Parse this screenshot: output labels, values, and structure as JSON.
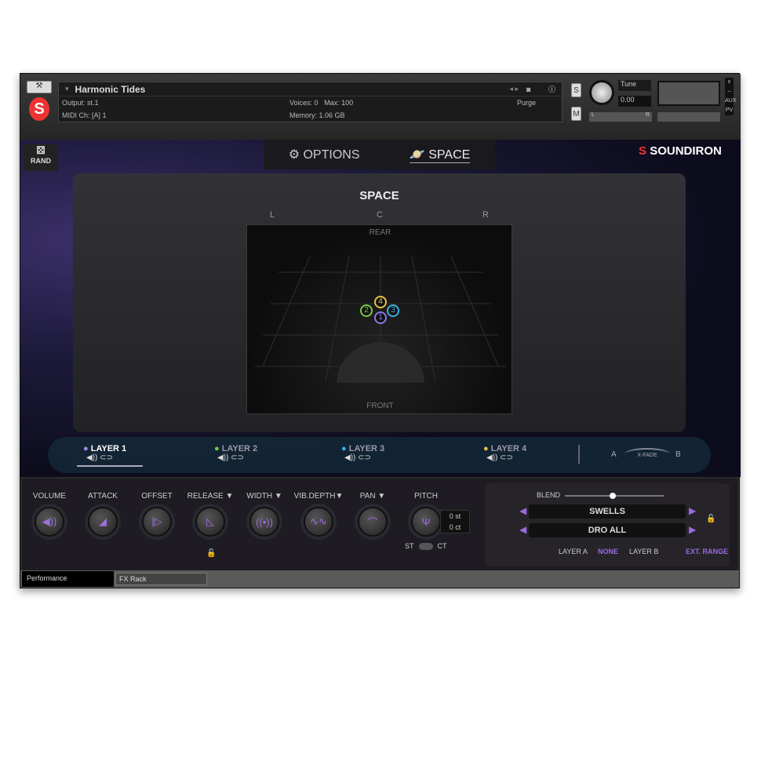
{
  "header": {
    "instrument_name": "Harmonic Tides",
    "output_label": "Output:",
    "output_value": "st.1",
    "midi_label": "MIDI Ch:",
    "midi_value": "[A] 1",
    "voices_label": "Voices:",
    "voices_value": "0",
    "max_label": "Max:",
    "max_value": "100",
    "memory_label": "Memory:",
    "memory_value": "1.06 GB",
    "purge_label": "Purge",
    "solo": "S",
    "mute": "M",
    "tune_label": "Tune",
    "tune_value": "0.00",
    "pan_l": "L",
    "pan_r": "R",
    "close": "x",
    "minimize": "–",
    "aux": "AUX",
    "pv": "PV"
  },
  "nav": {
    "rand_label": "RAND",
    "tabs": [
      {
        "label": "OPTIONS",
        "icon": "gear-icon"
      },
      {
        "label": "SPACE",
        "icon": "planet-icon",
        "active": true
      }
    ],
    "brand": "SOUNDIRON"
  },
  "space": {
    "title": "SPACE",
    "left": "L",
    "center": "C",
    "right": "R",
    "rear": "REAR",
    "front": "FRONT",
    "points": [
      {
        "label": "1",
        "color": "#8a78e8"
      },
      {
        "label": "2",
        "color": "#7ac64a"
      },
      {
        "label": "3",
        "color": "#3ab0e8"
      },
      {
        "label": "4",
        "color": "#e8c040"
      }
    ]
  },
  "layers": {
    "items": [
      {
        "label": "LAYER 1",
        "color": "#a08af0",
        "active": true
      },
      {
        "label": "LAYER 2",
        "color": "#7ac64a"
      },
      {
        "label": "LAYER 3",
        "color": "#3ab0e8"
      },
      {
        "label": "LAYER 4",
        "color": "#e8c040"
      }
    ],
    "xfade_a": "A",
    "xfade_b": "B",
    "xfade_label": "X-FADE"
  },
  "controls": {
    "knobs": [
      {
        "label": "VOLUME",
        "glyph": "◀))"
      },
      {
        "label": "ATTACK",
        "glyph": "◢"
      },
      {
        "label": "OFFSET",
        "glyph": "|▷"
      },
      {
        "label": "RELEASE ▼",
        "glyph": "◺"
      },
      {
        "label": "WIDTH ▼",
        "glyph": "((•))"
      },
      {
        "label": "VIB.DEPTH▼",
        "glyph": "∿∿"
      },
      {
        "label": "PAN ▼",
        "glyph": "⌒"
      },
      {
        "label": "PITCH",
        "glyph": "Ψ"
      }
    ],
    "pitch_st": "0 st",
    "pitch_ct": "0 ct",
    "switch_st": "ST",
    "switch_ct": "CT"
  },
  "blend": {
    "label": "BLEND",
    "value": 0.5,
    "select_a": "SWELLS",
    "select_b": "DRO ALL",
    "layer_a": "LAYER A",
    "none": "NONE",
    "layer_b": "LAYER B",
    "ext_range": "EXT. RANGE"
  },
  "bottom_tabs": [
    "Performance",
    "FX Rack"
  ]
}
